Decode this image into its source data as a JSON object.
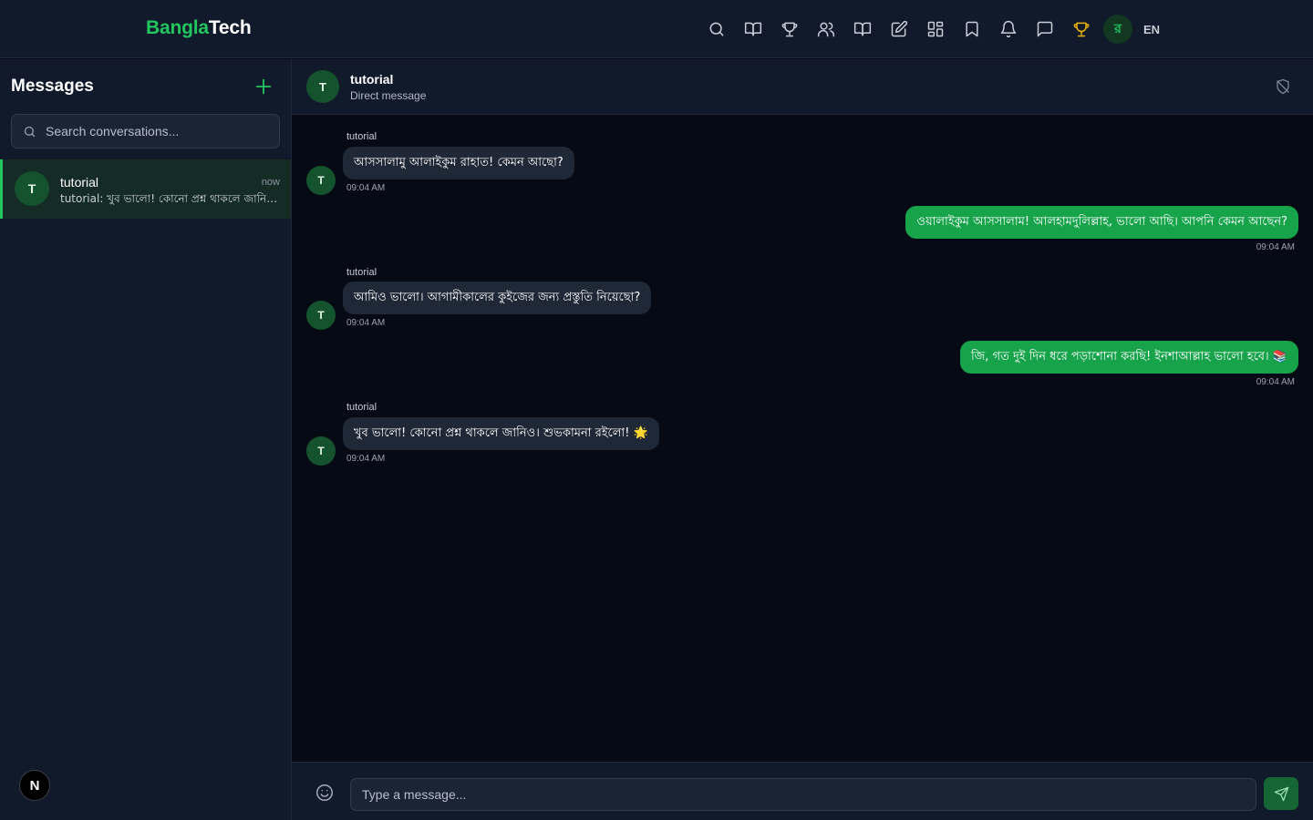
{
  "brand": {
    "part1": "Bangla",
    "part2": "Tech",
    "accent": "#22c55e"
  },
  "nav": {
    "icons": [
      "search-icon",
      "book-open-icon",
      "trophy-icon",
      "users-icon",
      "book-icon",
      "edit-icon",
      "grid-icon",
      "bookmark-icon",
      "bell-icon",
      "chat-icon",
      "trophy-gold-icon"
    ],
    "avatar_letter": "র",
    "lang": "EN"
  },
  "sidebar": {
    "title": "Messages",
    "search_placeholder": "Search conversations...",
    "conversations": [
      {
        "avatar": "T",
        "name": "tutorial",
        "time": "now",
        "preview": "tutorial: খুব ভালো! কোনো প্রশ্ন থাকলে জানিও। শুভকামনা রইলো!"
      }
    ],
    "badge": "N"
  },
  "chat": {
    "avatar": "T",
    "name": "tutorial",
    "subtitle": "Direct message",
    "messages": [
      {
        "dir": "in",
        "sender": "tutorial",
        "avatar": "T",
        "text": "আসসালামু আলাইকুম রাহাত! কেমন আছো?",
        "time": "09:04 AM"
      },
      {
        "dir": "out",
        "text": "ওয়ালাইকুম আসসালাম! আলহামদুলিল্লাহ, ভালো আছি। আপনি কেমন আছেন?",
        "time": "09:04 AM"
      },
      {
        "dir": "in",
        "sender": "tutorial",
        "avatar": "T",
        "text": "আমিও ভালো। আগামীকালের কুইজের জন্য প্রস্তুতি নিয়েছো?",
        "time": "09:04 AM"
      },
      {
        "dir": "out",
        "text": "জি, গত দুই দিন ধরে পড়াশোনা করছি! ইনশাআল্লাহ ভালো হবে। 📚",
        "time": "09:04 AM"
      },
      {
        "dir": "in",
        "sender": "tutorial",
        "avatar": "T",
        "text": "খুব ভালো! কোনো প্রশ্ন থাকলে জানিও। শুভকামনা রইলো! 🌟",
        "time": "09:04 AM"
      }
    ]
  },
  "composer": {
    "placeholder": "Type a message..."
  }
}
